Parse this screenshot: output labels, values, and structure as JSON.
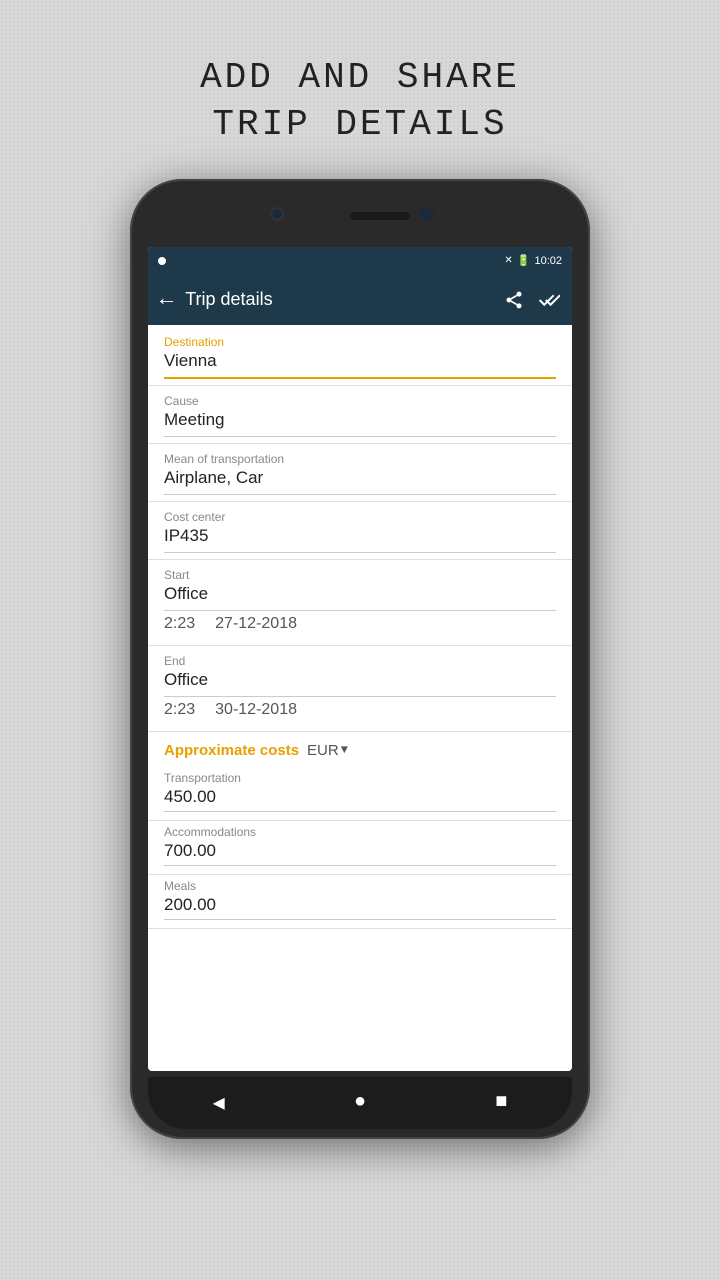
{
  "header": {
    "title": "Add and share\ntrip details"
  },
  "statusBar": {
    "time": "10:02",
    "batteryIcon": "🔋",
    "signalIcon": "✕"
  },
  "toolbar": {
    "title": "Trip details",
    "backLabel": "←",
    "shareIcon": "share",
    "checkIcon": "check"
  },
  "fields": {
    "destinationLabel": "Destination",
    "destinationValue": "Vienna",
    "causeLabel": "Cause",
    "causeValue": "Meeting",
    "transportLabel": "Mean of transportation",
    "transportValue": "Airplane, Car",
    "costCenterLabel": "Cost center",
    "costCenterValue": "IP435",
    "startLabel": "Start",
    "startValue": "Office",
    "startTime": "2:23",
    "startDate": "27-12-2018",
    "endLabel": "End",
    "endValue": "Office",
    "endTime": "2:23",
    "endDate": "30-12-2018"
  },
  "costs": {
    "sectionLabel": "Approximate costs",
    "currencyLabel": "EUR",
    "transportationLabel": "Transportation",
    "transportationValue": "450.00",
    "accommodationsLabel": "Accommodations",
    "accommodationsValue": "700.00",
    "mealsLabel": "Meals",
    "mealsValue": "200.00"
  },
  "navBar": {
    "backBtn": "◀",
    "homeBtn": "●",
    "squareBtn": "■"
  }
}
